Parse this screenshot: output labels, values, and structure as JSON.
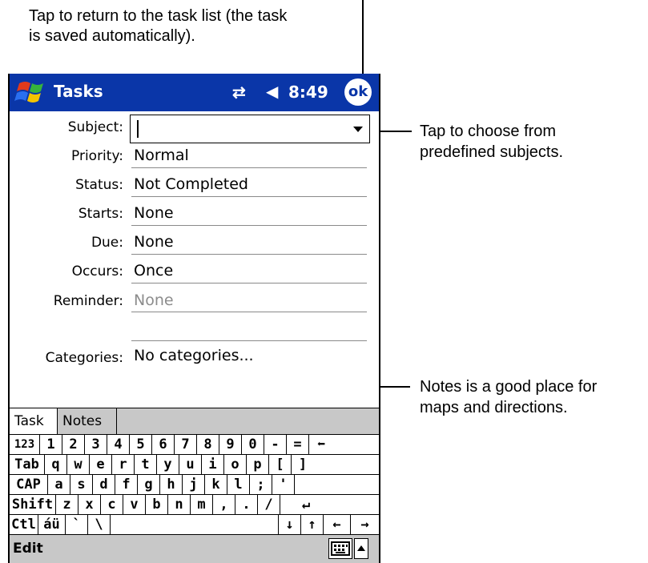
{
  "callouts": {
    "top_line1": "Tap to return to the task list (the task",
    "top_line2": "is saved automatically).",
    "subject_line1": "Tap to choose from",
    "subject_line2": "predefined subjects.",
    "notes_line1": "Notes is a good place for",
    "notes_line2": "maps and directions."
  },
  "titlebar": {
    "title": "Tasks",
    "time": "8:49",
    "ok_label": "ok",
    "connectivity_glyph": "⇄",
    "speaker_glyph": "◀",
    "accent": "#0a36a8"
  },
  "form": {
    "subject_label": "Subject:",
    "subject_value": "",
    "priority_label": "Priority:",
    "priority_value": "Normal",
    "status_label": "Status:",
    "status_value": "Not Completed",
    "starts_label": "Starts:",
    "starts_value": "None",
    "due_label": "Due:",
    "due_value": "None",
    "occurs_label": "Occurs:",
    "occurs_value": "Once",
    "reminder_label": "Reminder:",
    "reminder_value": "None",
    "categories_label": "Categories:",
    "categories_value": "No categories..."
  },
  "tabs": {
    "task": "Task",
    "notes": "Notes"
  },
  "keyboard": {
    "row1": [
      "123",
      "1",
      "2",
      "3",
      "4",
      "5",
      "6",
      "7",
      "8",
      "9",
      "0",
      "-",
      "=",
      "⬅"
    ],
    "row2": [
      "Tab",
      "q",
      "w",
      "e",
      "r",
      "t",
      "y",
      "u",
      "i",
      "o",
      "p",
      "[",
      "]"
    ],
    "row3": [
      "CAP",
      "a",
      "s",
      "d",
      "f",
      "g",
      "h",
      "j",
      "k",
      "l",
      ";",
      "'"
    ],
    "row4": [
      "Shift",
      "z",
      "x",
      "c",
      "v",
      "b",
      "n",
      "m",
      ",",
      ".",
      "/",
      "↵"
    ],
    "row5": [
      "Ctl",
      "áü",
      "`",
      "\\",
      "↓",
      "↑",
      "←",
      "→"
    ]
  },
  "menubar": {
    "edit": "Edit"
  }
}
